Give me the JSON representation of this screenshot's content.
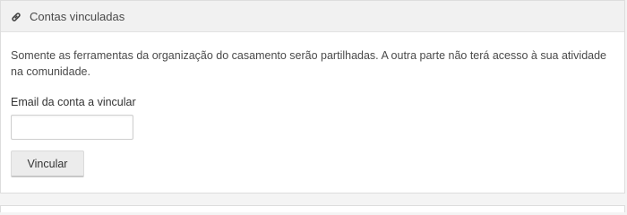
{
  "panel": {
    "icon": "link-icon",
    "title": "Contas vinculadas",
    "description": "Somente as ferramentas da organização do casamento serão partilhadas. A outra parte não terá acesso à sua atividade na comunidade."
  },
  "form": {
    "email_label": "Email da conta a vincular",
    "email_value": "",
    "email_placeholder": "",
    "submit_label": "Vincular"
  }
}
